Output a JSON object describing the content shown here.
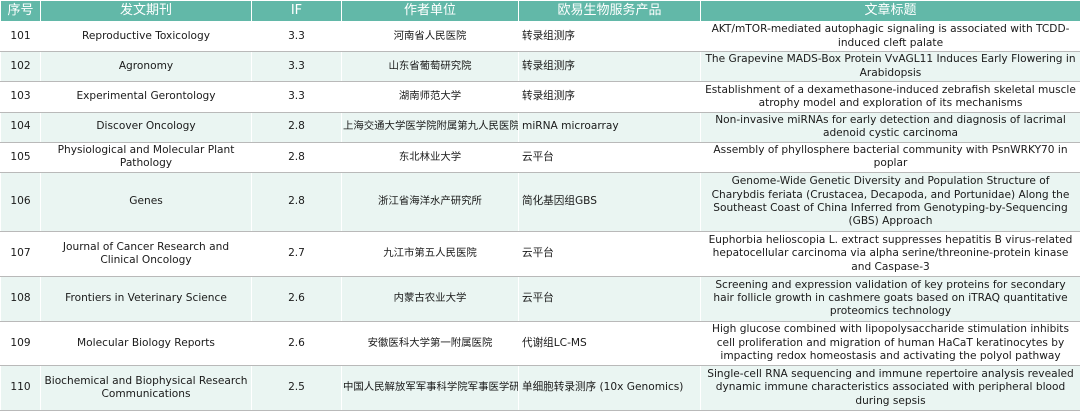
{
  "headers": [
    "序号",
    "发文期刊",
    "IF",
    "作者单位",
    "欧易生物服务产品",
    "文章标题"
  ],
  "rows": [
    {
      "no": "101",
      "journal": "Reproductive Toxicology",
      "if": "3.3",
      "affiliation": "河南省人民医院",
      "service": "转录组测序",
      "title": "AKT/mTOR-mediated autophagic signaling is associated with TCDD-induced cleft palate"
    },
    {
      "no": "102",
      "journal": "Agronomy",
      "if": "3.3",
      "affiliation": "山东省葡萄研究院",
      "service": "转录组测序",
      "title": "The Grapevine MADS-Box Protein VvAGL11 Induces Early Flowering in Arabidopsis"
    },
    {
      "no": "103",
      "journal": "Experimental Gerontology",
      "if": "3.3",
      "affiliation": "湖南师范大学",
      "service": "转录组测序",
      "title": "Establishment of a dexamethasone-induced zebrafish skeletal muscle atrophy model and exploration of its mechanisms"
    },
    {
      "no": "104",
      "journal": "Discover Oncology",
      "if": "2.8",
      "affiliation": "上海交通大学医学院附属第九人民医院",
      "service": "miRNA microarray",
      "title": "Non-invasive miRNAs for early detection and diagnosis of lacrimal adenoid cystic carcinoma"
    },
    {
      "no": "105",
      "journal": "Physiological and Molecular Plant Pathology",
      "if": "2.8",
      "affiliation": "东北林业大学",
      "service": "云平台",
      "title": "Assembly of phyllosphere bacterial community with PsnWRKY70 in poplar"
    },
    {
      "no": "106",
      "journal": "Genes",
      "if": "2.8",
      "affiliation": "浙江省海洋水产研究所",
      "service": "简化基因组GBS",
      "title": "Genome-Wide Genetic Diversity and Population Structure of Charybdis feriata (Crustacea, Decapoda, and Portunidae) Along the Southeast Coast of China Inferred from Genotyping-by-Sequencing (GBS) Approach"
    },
    {
      "no": "107",
      "journal": "Journal of Cancer Research and Clinical Oncology",
      "if": "2.7",
      "affiliation": "九江市第五人民医院",
      "service": "云平台",
      "title": "Euphorbia helioscopia L. extract suppresses hepatitis B virus-related hepatocellular carcinoma via alpha serine/threonine-protein kinase and Caspase-3"
    },
    {
      "no": "108",
      "journal": "Frontiers in Veterinary Science",
      "if": "2.6",
      "affiliation": "内蒙古农业大学",
      "service": "云平台",
      "title": "Screening and expression validation of key proteins for secondary hair follicle growth in cashmere goats based on iTRAQ quantitative proteomics technology"
    },
    {
      "no": "109",
      "journal": "Molecular Biology Reports",
      "if": "2.6",
      "affiliation": "安徽医科大学第一附属医院",
      "service": "代谢组LC-MS",
      "title": "High glucose combined with lipopolysaccharide stimulation inhibits cell proliferation and migration of human HaCaT keratinocytes by impacting redox homeostasis and activating the polyol pathway"
    },
    {
      "no": "110",
      "journal": "Biochemical and Biophysical Research Communications",
      "if": "2.5",
      "affiliation": "中国人民解放军军事科学院军事医学研究院",
      "service": "单细胞转录测序 (10x Genomics)",
      "title": "Single-cell RNA sequencing and immune repertoire analysis revealed dynamic immune characteristics associated with peripheral blood during sepsis"
    }
  ]
}
